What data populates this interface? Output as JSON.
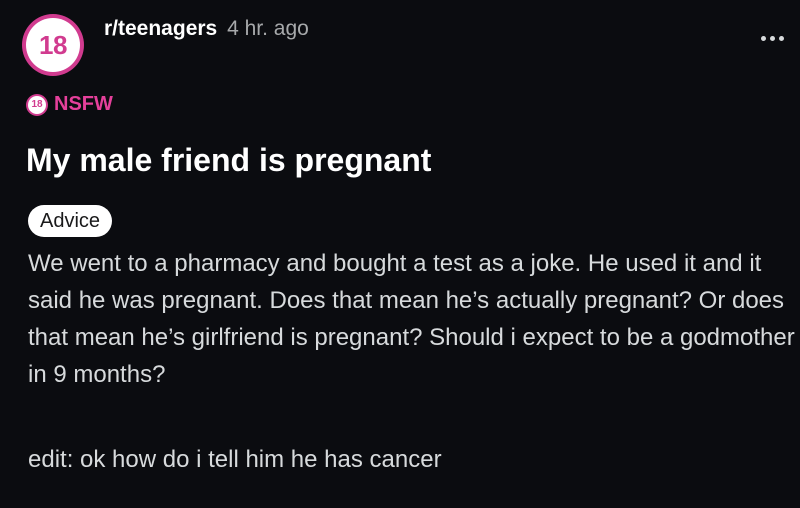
{
  "post": {
    "avatar_text": "18",
    "subreddit": "r/teenagers",
    "age": "4 hr. ago",
    "more_icon": "ellipsis-horizontal-icon",
    "nsfw_badge_text": "18",
    "nsfw_label": "NSFW",
    "title": "My male friend is pregnant",
    "flair": "Advice",
    "body": "We went to a pharmacy and bought a test as a joke. He used it and it said he was pregnant. Does that mean he’s actually pregnant? Or does that mean he’s girlfriend is pregnant? Should i expect to be a godmother in 9 months?",
    "edit": "edit: ok how do i tell him he has cancer"
  },
  "colors": {
    "background": "#0b0c10",
    "nsfw_accent": "#d13b8f",
    "text": "#d7dadc"
  }
}
